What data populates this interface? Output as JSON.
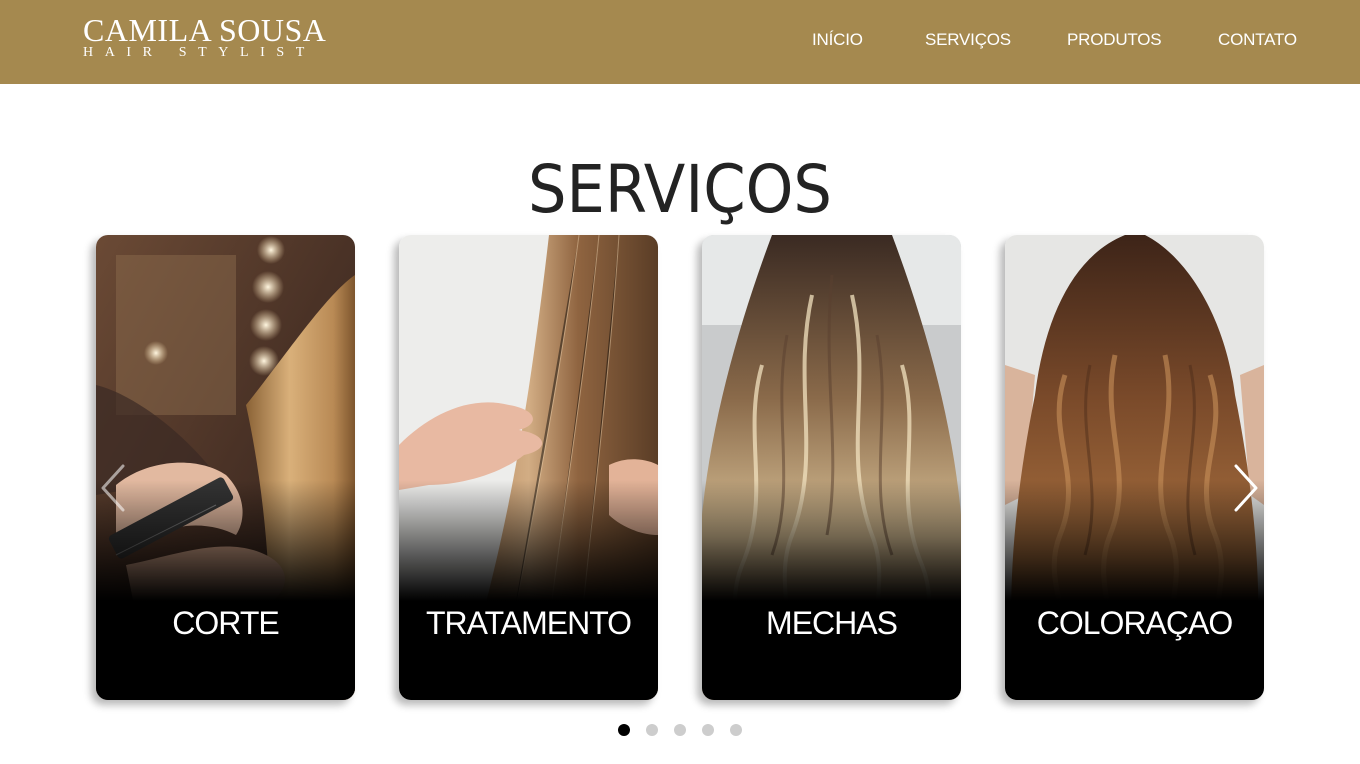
{
  "header": {
    "brand_name": "CAMILA SOUSA",
    "brand_tagline": "HAIR STYLIST",
    "brand_color": "#a5894f",
    "nav": [
      {
        "label": "INÍCIO"
      },
      {
        "label": "SERVIÇOS"
      },
      {
        "label": "PRODUTOS"
      },
      {
        "label": "CONTATO"
      }
    ]
  },
  "section": {
    "title": "SERVIÇOS"
  },
  "carousel": {
    "cards": [
      {
        "label": "CORTE",
        "image": "hair-cutting-photo"
      },
      {
        "label": "TRATAMENTO",
        "image": "straight-hair-treatment-photo"
      },
      {
        "label": "MECHAS",
        "image": "balayage-highlights-photo"
      },
      {
        "label": "COLORAÇAO",
        "image": "wavy-brown-hair-color-photo"
      }
    ],
    "prev_icon": "chevron-left-icon",
    "next_icon": "chevron-right-icon",
    "page_count": 5,
    "active_page": 1
  }
}
